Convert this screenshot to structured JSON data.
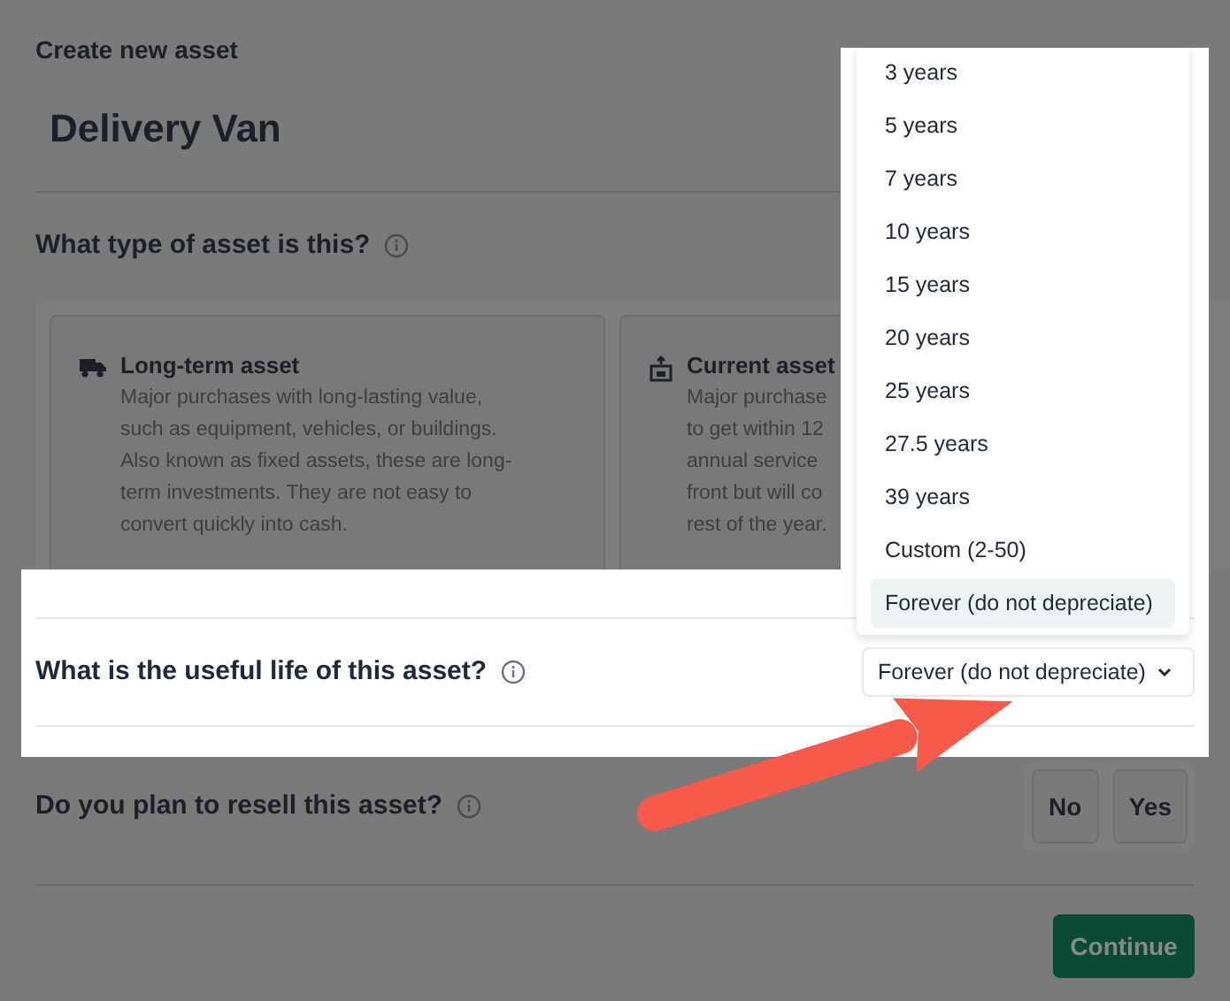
{
  "dialog": {
    "title": "Create new asset",
    "name": "Delivery Van"
  },
  "asset_type": {
    "label": "What type of asset is this?",
    "options": [
      {
        "kind": "vehicle",
        "title": "Long-term asset",
        "lines": [
          "Major purchases with long-lasting value,",
          "such as equipment, vehicles, or buildings.",
          "Also known as fixed assets, these are long-",
          "term investments. They are not easy to",
          "convert quickly into cash."
        ],
        "selected": false
      },
      {
        "kind": "stock",
        "title": "Current asset",
        "lines": [
          "Major purchase",
          "to get within 12",
          "annual service",
          "front but will co",
          "rest of the year."
        ],
        "selected": false
      }
    ]
  },
  "useful_life": {
    "label": "What is the useful life of this asset?",
    "value": "Forever (do not depreciate)",
    "expanded": true,
    "options": [
      {
        "label": "3 years",
        "selected": false
      },
      {
        "label": "5 years",
        "selected": false
      },
      {
        "label": "7 years",
        "selected": false
      },
      {
        "label": "10 years",
        "selected": false
      },
      {
        "label": "15 years",
        "selected": false
      },
      {
        "label": "20 years",
        "selected": false
      },
      {
        "label": "25 years",
        "selected": false
      },
      {
        "label": "27.5 years",
        "selected": false
      },
      {
        "label": "39 years",
        "selected": false
      },
      {
        "label": "Custom (2-50)",
        "selected": false
      },
      {
        "label": "Forever (do not depreciate)",
        "selected": true
      }
    ]
  },
  "resell": {
    "label": "Do you plan to resell this asset?",
    "options": [
      {
        "label": "No",
        "selected": false
      },
      {
        "label": "Yes",
        "selected": false
      }
    ]
  },
  "continue_button": "Continue"
}
